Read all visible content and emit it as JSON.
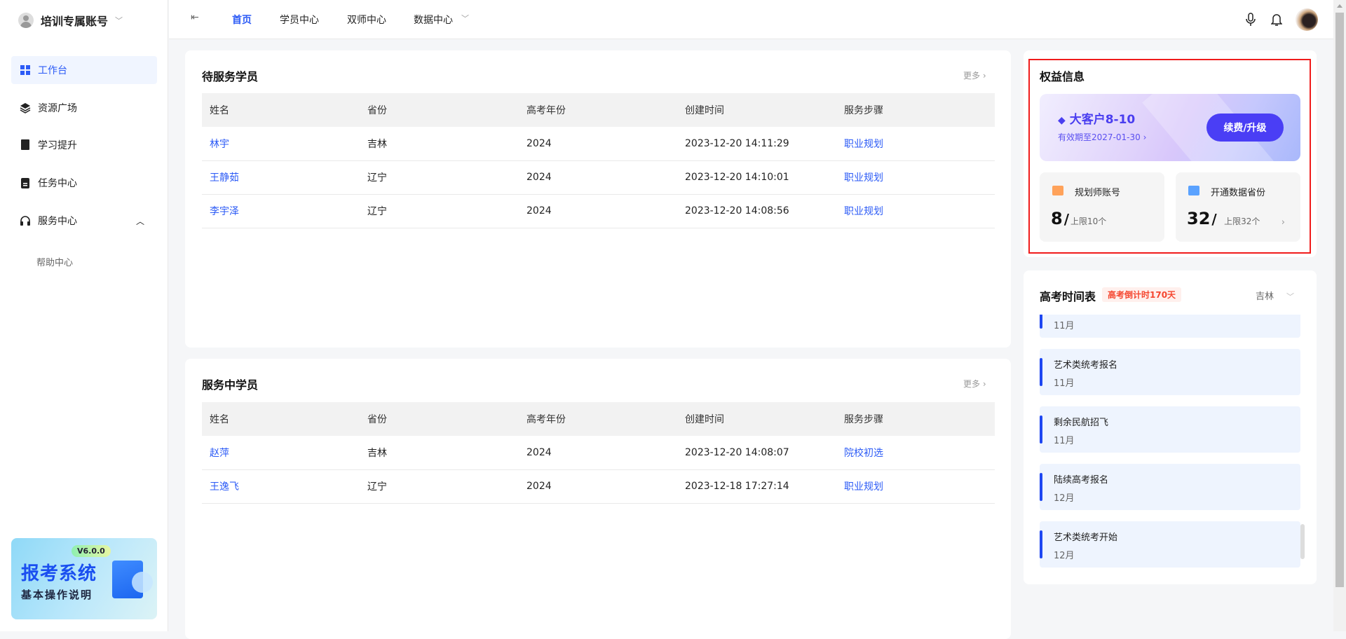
{
  "sidebar": {
    "account": "培训专属账号",
    "items": [
      {
        "label": "工作台",
        "icon": "dashboard-icon"
      },
      {
        "label": "资源广场",
        "icon": "layers-icon"
      },
      {
        "label": "学习提升",
        "icon": "book-icon"
      },
      {
        "label": "任务中心",
        "icon": "clipboard-icon"
      },
      {
        "label": "服务中心",
        "icon": "headset-icon"
      }
    ],
    "sub_item": "帮助中心",
    "banner": {
      "version": "V6.0.0",
      "title": "报考系统",
      "subtitle": "基本操作说明"
    }
  },
  "topnav": {
    "items": [
      "首页",
      "学员中心",
      "双师中心",
      "数据中心"
    ]
  },
  "pending": {
    "title": "待服务学员",
    "more": "更多",
    "columns": [
      "姓名",
      "省份",
      "高考年份",
      "创建时间",
      "服务步骤"
    ],
    "rows": [
      [
        "林宇",
        "吉林",
        "2024",
        "2023-12-20 14:11:29",
        "职业规划"
      ],
      [
        "王静茹",
        "辽宁",
        "2024",
        "2023-12-20 14:10:01",
        "职业规划"
      ],
      [
        "李宇泽",
        "辽宁",
        "2024",
        "2023-12-20 14:08:56",
        "职业规划"
      ]
    ]
  },
  "serving": {
    "title": "服务中学员",
    "more": "更多",
    "columns": [
      "姓名",
      "省份",
      "高考年份",
      "创建时间",
      "服务步骤"
    ],
    "rows": [
      [
        "赵萍",
        "吉林",
        "2024",
        "2023-12-20 14:08:07",
        "院校初选"
      ],
      [
        "王逸飞",
        "辽宁",
        "2024",
        "2023-12-18 17:27:14",
        "职业规划"
      ]
    ]
  },
  "benefits": {
    "title": "权益信息",
    "plan": "大客户8-10",
    "expiry": "有效期至2027-01-30",
    "renew": "续费/升级",
    "planner": {
      "label": "规划师账号",
      "value": "8",
      "limit": "上限10个"
    },
    "provinces": {
      "label": "开通数据省份",
      "value": "32",
      "limit": "上限32个"
    }
  },
  "schedule": {
    "title": "高考时间表",
    "countdown": "高考倒计时170天",
    "province": "吉林",
    "items": [
      {
        "title": "",
        "month": "11月"
      },
      {
        "title": "艺术类统考报名",
        "month": "11月"
      },
      {
        "title": "剩余民航招飞",
        "month": "11月"
      },
      {
        "title": "陆续高考报名",
        "month": "12月"
      },
      {
        "title": "艺术类统考开始",
        "month": "12月"
      }
    ]
  },
  "colors": {
    "accent": "#2c5bf6",
    "vip": "#4a3ef5",
    "highlight": "#f01c1c"
  }
}
